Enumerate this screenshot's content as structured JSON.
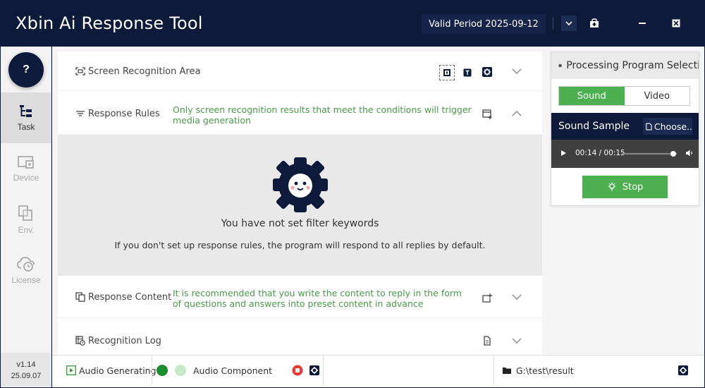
{
  "window": {
    "title": "Xbin Ai Response Tool",
    "valid_period": "Valid Period 2025-09-12"
  },
  "nav": {
    "help": "?",
    "items": [
      {
        "label": "Task",
        "icon": "task-icon",
        "active": true
      },
      {
        "label": "Device",
        "icon": "device-icon",
        "active": false
      },
      {
        "label": "Env.",
        "icon": "environment-icon",
        "active": false
      },
      {
        "label": "License",
        "icon": "license-icon",
        "active": false
      }
    ],
    "version": "v1.14",
    "build_date": "25.09.07"
  },
  "sections": {
    "screen": {
      "label": "Screen Recognition Area"
    },
    "rules": {
      "label": "Response Rules",
      "desc_line1": "Only screen recognition results that meet the conditions will trigger",
      "desc_line2": "media generation"
    },
    "empty": {
      "title": "You have not set filter keywords",
      "subtitle": "If you don't set up response rules, the program will respond to all replies by default."
    },
    "content": {
      "label": "Response Content",
      "desc_line1": "It is recommended that you write the content to reply in the form",
      "desc_line2": "of questions and answers into preset content in advance"
    },
    "log": {
      "label": "Recognition Log"
    }
  },
  "program_panel": {
    "title": "Processing Program Selecti",
    "tabs": {
      "sound": "Sound",
      "video": "Video",
      "selected": "Sound"
    },
    "sample_label": "Sound Sample",
    "choose_label": "Choose..",
    "player_time": "00:14 / 00:15",
    "player_progress": 0.93,
    "stop_label": "Stop"
  },
  "status": {
    "audio_generating": "Audio Generating",
    "audio_component": "Audio Component",
    "path": "G:\\test\\result"
  },
  "colors": {
    "navy": "#0d1a3a",
    "green": "#4caf50",
    "hint_green": "#4a9a4a",
    "red": "#e53935"
  }
}
